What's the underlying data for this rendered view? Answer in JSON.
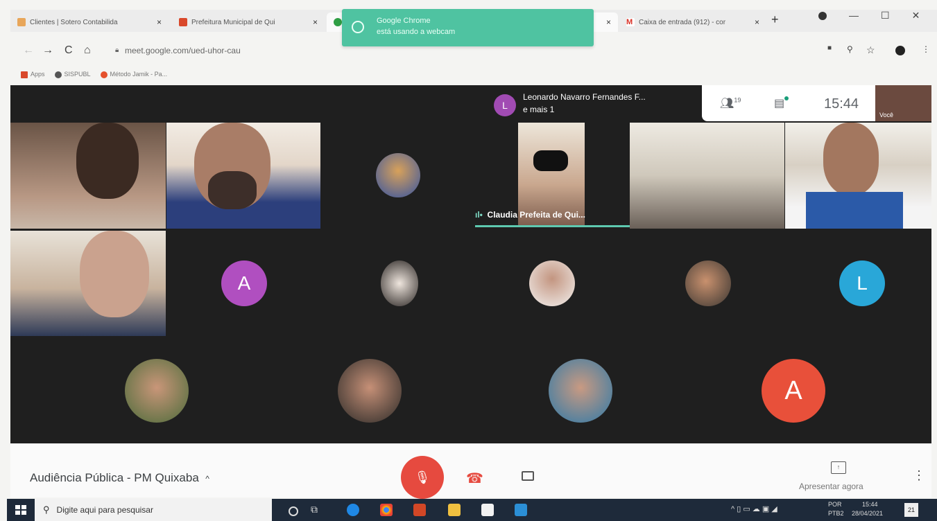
{
  "browser": {
    "tabs": [
      {
        "title": "Clientes | Sotero Contabilida",
        "close": "×",
        "icon": "sotero-favicon"
      },
      {
        "title": "Prefeitura Municipal de Qui",
        "close": "×",
        "icon": "prefeitura-favicon"
      },
      {
        "title": "(",
        "close": "×",
        "icon": "meet-favicon"
      },
      {
        "title": "Caixa de entrada (912) - cor",
        "close": "×",
        "icon": "gmail-favicon"
      }
    ],
    "new_tab": "+",
    "window_controls": [
      "—",
      "☐",
      "✕"
    ],
    "nav": {
      "back": "←",
      "forward": "→",
      "reload": "C",
      "home": "⌂"
    },
    "url": "meet.google.com/ued-uhor-cau",
    "bookmarks": [
      {
        "label": "Apps",
        "color": "#d9482b"
      },
      {
        "label": "SISPUBL",
        "color": "#555555"
      },
      {
        "label": "Método Jamik - Pa...",
        "color": "#e5512d"
      }
    ]
  },
  "notification": {
    "line1": "Google Chrome",
    "line2": "está usando a webcam",
    "icon": "webcam-icon"
  },
  "meet": {
    "speaker_badge": "L",
    "speaker_name": "Leonardo Navarro Fernandes F...",
    "speaker_more": "e mais 1",
    "participants_icon": "people-icon",
    "participants_count": "19",
    "chat_icon": "chat-icon",
    "clock": "15:44",
    "self_label": "Você",
    "active_speaker_label": "Claudia Prefeita de Qui...",
    "avatars": [
      {
        "letter": "A",
        "color": "#b04fc0"
      },
      {
        "letter": "L",
        "color": "#29a7d8"
      },
      {
        "letter": "A",
        "color": "#e8503a"
      }
    ],
    "meeting_title": "Audiência Pública - PM Quixaba",
    "meeting_title_chevron": "^",
    "present_label": "Apresentar agora",
    "more": "⋮"
  },
  "taskbar": {
    "search_placeholder": "Digite aqui para pesquisar",
    "lang": "POR",
    "lang2": "PTB2",
    "time": "15:44",
    "date": "28/04/2021",
    "notifications": "21"
  }
}
